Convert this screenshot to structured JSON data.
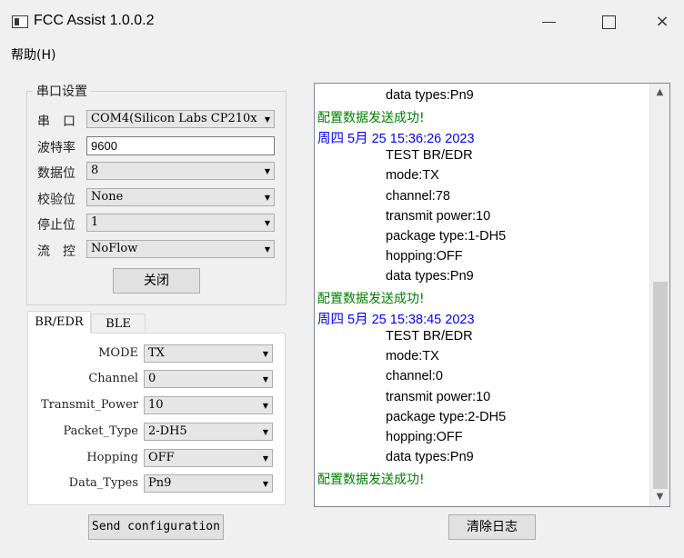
{
  "window": {
    "title": "FCC Assist 1.0.0.2",
    "minimize_glyph": "",
    "close_glyph": "×"
  },
  "menu": {
    "help": "帮助(H)"
  },
  "serial": {
    "group_title": "串口设置",
    "port_label": "串　口",
    "port_value": "COM4(Silicon Labs CP210x",
    "baud_label": "波特率",
    "baud_value": "9600",
    "databits_label": "数据位",
    "databits_value": "8",
    "parity_label": "校验位",
    "parity_value": "None",
    "stopbits_label": "停止位",
    "stopbits_value": "1",
    "flow_label": "流　控",
    "flow_value": "NoFlow",
    "close_button": "关闭"
  },
  "tabs": {
    "active": "BR/EDR",
    "inactive": "BLE"
  },
  "bredr": {
    "mode_label": "MODE",
    "mode_value": "TX",
    "channel_label": "Channel",
    "channel_value": "0",
    "power_label": "Transmit_Power",
    "power_value": "10",
    "packet_label": "Packet_Type",
    "packet_value": "2-DH5",
    "hopping_label": "Hopping",
    "hopping_value": "OFF",
    "datatypes_label": "Data_Types",
    "datatypes_value": "Pn9"
  },
  "send_button": "Send configuration",
  "clear_button": "清除日志",
  "log": {
    "lines": [
      {
        "kind": "indent",
        "text": "data types:Pn9"
      },
      {
        "kind": "ok",
        "text": "配置数据发送成功!"
      },
      {
        "kind": "ts",
        "text": "周四 5月 25 15:36:26 2023"
      },
      {
        "kind": "indent",
        "text": "TEST BR/EDR"
      },
      {
        "kind": "indent",
        "text": "mode:TX"
      },
      {
        "kind": "indent",
        "text": "channel:78"
      },
      {
        "kind": "indent",
        "text": "transmit power:10"
      },
      {
        "kind": "indent",
        "text": "package type:1-DH5"
      },
      {
        "kind": "indent",
        "text": "hopping:OFF"
      },
      {
        "kind": "indent",
        "text": "data types:Pn9"
      },
      {
        "kind": "ok",
        "text": "配置数据发送成功!"
      },
      {
        "kind": "ts",
        "text": "周四 5月 25 15:38:45 2023"
      },
      {
        "kind": "indent",
        "text": "TEST BR/EDR"
      },
      {
        "kind": "indent",
        "text": "mode:TX"
      },
      {
        "kind": "indent",
        "text": "channel:0"
      },
      {
        "kind": "indent",
        "text": "transmit power:10"
      },
      {
        "kind": "indent",
        "text": "package type:2-DH5"
      },
      {
        "kind": "indent",
        "text": "hopping:OFF"
      },
      {
        "kind": "indent",
        "text": "data types:Pn9"
      },
      {
        "kind": "ok",
        "text": "配置数据发送成功!"
      }
    ]
  },
  "icons": {
    "dropdown_arrow": "chevron-down-icon",
    "scroll_up": "scroll-up-icon",
    "scroll_down": "scroll-down-icon"
  },
  "colors": {
    "success_text": "#008000",
    "timestamp_text": "#0000ff"
  }
}
